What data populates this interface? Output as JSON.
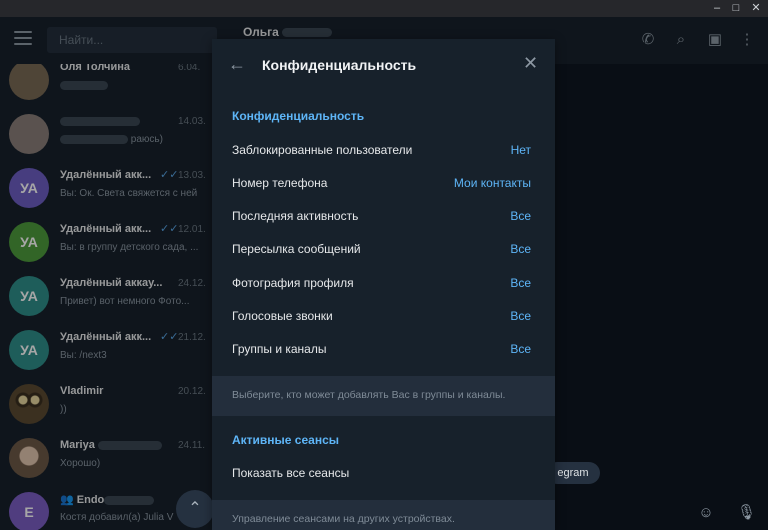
{
  "window": {
    "controls": [
      {
        "name": "minimize-button",
        "glyph": "–"
      },
      {
        "name": "maximize-button",
        "glyph": "□"
      },
      {
        "name": "close-window-button",
        "glyph": "✕"
      }
    ]
  },
  "search": {
    "placeholder": "Найти..."
  },
  "chat_header": {
    "title": "Ольга"
  },
  "top_icons": [
    {
      "name": "call-icon",
      "glyph": "✆"
    },
    {
      "name": "search-icon",
      "glyph": "⌕"
    },
    {
      "name": "sidebar-toggle-icon",
      "glyph": "▣"
    },
    {
      "name": "more-icon",
      "glyph": "⋮"
    }
  ],
  "chats": [
    {
      "name": "Оля Толчина",
      "time": "6.04.",
      "message": "",
      "initials": "",
      "color": "#7a6a55",
      "check": ""
    },
    {
      "name": "",
      "time": "14.03.",
      "message": "раюсь)",
      "initials": "",
      "color": "#8a7f7a",
      "check": ""
    },
    {
      "name": "Удалённый акк...",
      "time": "13.03.",
      "message": "Вы: Ок. Света свяжется с ней",
      "initials": "УА",
      "color": "#6d5fc4",
      "check": "✓✓"
    },
    {
      "name": "Удалённый акк...",
      "time": "12.01.",
      "message": "Вы: в группу детского сада, ...",
      "initials": "УА",
      "color": "#4e9b3c",
      "check": "✓✓"
    },
    {
      "name": "Удалённый аккау...",
      "time": "24.12.",
      "message": "Привет) вот немного Фото...",
      "initials": "УА",
      "color": "#2f8f8a",
      "check": ""
    },
    {
      "name": "Удалённый акк...",
      "time": "21.12.",
      "message": "Вы: /next3",
      "initials": "УА",
      "color": "#2f8f8a",
      "check": "✓✓"
    },
    {
      "name": "Vladimir",
      "time": "20.12.",
      "message": "))",
      "initials": "",
      "color": "#5b4a32",
      "check": ""
    },
    {
      "name": "Mariya",
      "time": "24.11.",
      "message": "Хорошо)",
      "initials": "",
      "color": "#a08a7a",
      "check": ""
    },
    {
      "name": "Endo",
      "time": "",
      "message": "Костя добавил(а) Julia V",
      "initials": "E",
      "color": "#7c5ec4",
      "check": ""
    }
  ],
  "pill": {
    "text": "egram"
  },
  "scroll_down": {
    "glyph": "⌃"
  },
  "bottom_icons": [
    {
      "name": "emoji-icon",
      "glyph": "☺"
    },
    {
      "name": "microphone-icon",
      "glyph": "🎙"
    }
  ],
  "modal": {
    "back_glyph": "←",
    "title": "Конфиденциальность",
    "close_glyph": "✕",
    "privacy_section": "Конфиденциальность",
    "rows": [
      {
        "label": "Заблокированные пользователи",
        "value": "Нет"
      },
      {
        "label": "Номер телефона",
        "value": "Мои контакты"
      },
      {
        "label": "Последняя активность",
        "value": "Все"
      },
      {
        "label": "Пересылка сообщений",
        "value": "Все"
      },
      {
        "label": "Фотография профиля",
        "value": "Все"
      },
      {
        "label": "Голосовые звонки",
        "value": "Все"
      },
      {
        "label": "Группы и каналы",
        "value": "Все"
      }
    ],
    "groups_note": "Выберите, кто может добавлять Вас в группы и каналы.",
    "sessions_section": "Активные сеансы",
    "show_sessions": "Показать все сеансы",
    "sessions_note": "Управление сеансами на других устройствах."
  }
}
